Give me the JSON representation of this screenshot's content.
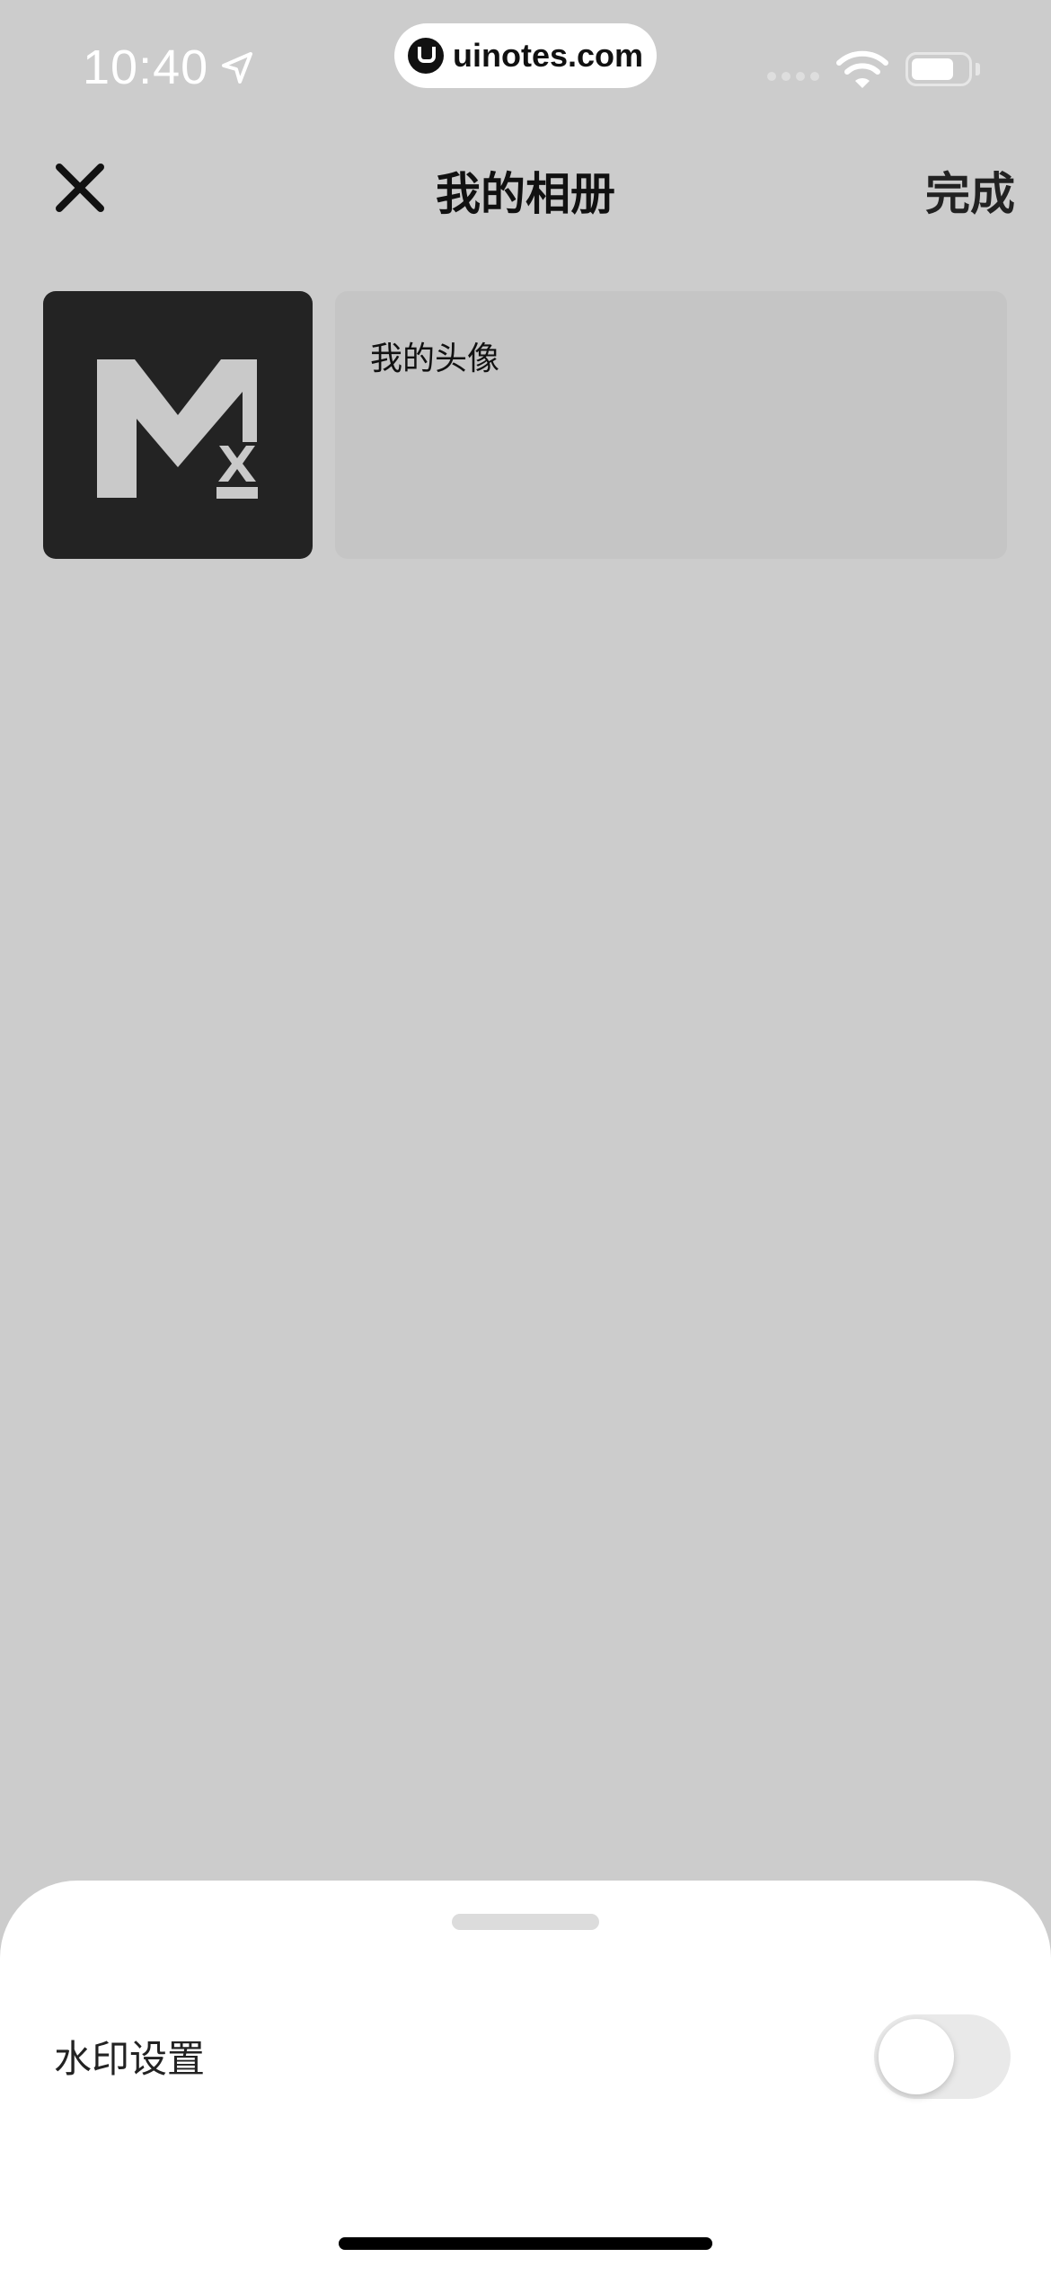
{
  "status_bar": {
    "time": "10:40",
    "site_badge": "uinotes.com",
    "icons": [
      "location-arrow-icon",
      "signal-icon",
      "wifi-icon",
      "battery-icon"
    ]
  },
  "nav": {
    "close_icon": "close-icon",
    "title": "我的相册",
    "done_label": "完成"
  },
  "album": {
    "cover_icon": "mx-logo",
    "name": "我的头像"
  },
  "sheet": {
    "watermark_label": "水印设置",
    "watermark_enabled": false
  },
  "colors": {
    "background": "#cccccc",
    "thumb_bg": "#232323",
    "field_bg": "#c5c5c5",
    "sheet_bg": "#ffffff",
    "toggle_off": "#e9e9e9"
  }
}
